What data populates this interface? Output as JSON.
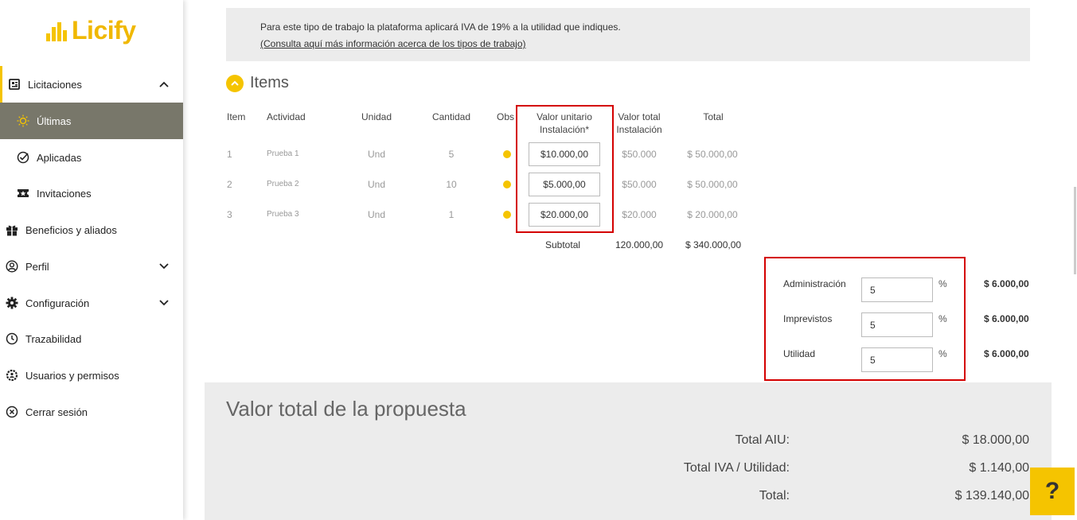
{
  "brand": {
    "name": "Licify"
  },
  "sidebar": {
    "items": [
      {
        "label": "Licitaciones",
        "icon": "licitaciones-icon"
      },
      {
        "label": "Últimas",
        "icon": "sun-icon"
      },
      {
        "label": "Aplicadas",
        "icon": "check-circle-icon"
      },
      {
        "label": "Invitaciones",
        "icon": "ticket-icon"
      },
      {
        "label": "Beneficios y aliados",
        "icon": "gift-icon"
      },
      {
        "label": "Perfil",
        "icon": "user-circle-icon"
      },
      {
        "label": "Configuración",
        "icon": "gear-icon"
      },
      {
        "label": "Trazabilidad",
        "icon": "history-icon"
      },
      {
        "label": "Usuarios y permisos",
        "icon": "users-gear-icon"
      },
      {
        "label": "Cerrar sesión",
        "icon": "close-circle-icon"
      }
    ]
  },
  "info": {
    "text": "Para este tipo de trabajo la plataforma aplicará IVA de 19% a la utilidad que indiques.",
    "link": "(Consulta aquí más información acerca de los tipos de trabajo)"
  },
  "items_section": {
    "title": "Items",
    "headers": {
      "item": "Item",
      "actividad": "Actividad",
      "unidad": "Unidad",
      "cantidad": "Cantidad",
      "obs": "Obs",
      "valor_unitario_1": "Valor unitario",
      "valor_unitario_2": "Instalación*",
      "valor_total_1": "Valor total",
      "valor_total_2": "Instalación",
      "total": "Total"
    },
    "rows": [
      {
        "item": "1",
        "actividad": "Prueba 1",
        "unidad": "Und",
        "cantidad": "5",
        "valor_unitario": "$10.000,00",
        "valor_total": "$50.000",
        "total": "$ 50.000,00"
      },
      {
        "item": "2",
        "actividad": "Prueba 2",
        "unidad": "Und",
        "cantidad": "10",
        "valor_unitario": "$5.000,00",
        "valor_total": "$50.000",
        "total": "$ 50.000,00"
      },
      {
        "item": "3",
        "actividad": "Prueba 3",
        "unidad": "Und",
        "cantidad": "1",
        "valor_unitario": "$20.000,00",
        "valor_total": "$20.000",
        "total": "$ 20.000,00"
      }
    ],
    "subtotal_label": "Subtotal",
    "subtotal_valor": "120.000,00",
    "subtotal_total": "$ 340.000,00"
  },
  "aiu": [
    {
      "label": "Administración",
      "value": "5",
      "pct": "%",
      "amount": "$ 6.000,00"
    },
    {
      "label": "Imprevistos",
      "value": "5",
      "pct": "%",
      "amount": "$ 6.000,00"
    },
    {
      "label": "Utilidad",
      "value": "5",
      "pct": "%",
      "amount": "$ 6.000,00"
    }
  ],
  "totals": {
    "title": "Valor total de la propuesta",
    "aiu_label": "Total AIU:",
    "aiu_value": "$ 18.000,00",
    "iva_label": "Total IVA / Utilidad:",
    "iva_value": "$ 1.140,00",
    "total_label": "Total:",
    "total_value": "$ 139.140,00"
  },
  "help": {
    "label": "?"
  },
  "colors": {
    "accent": "#f5c400",
    "active_bg": "#78776a",
    "highlight": "#d40000"
  }
}
